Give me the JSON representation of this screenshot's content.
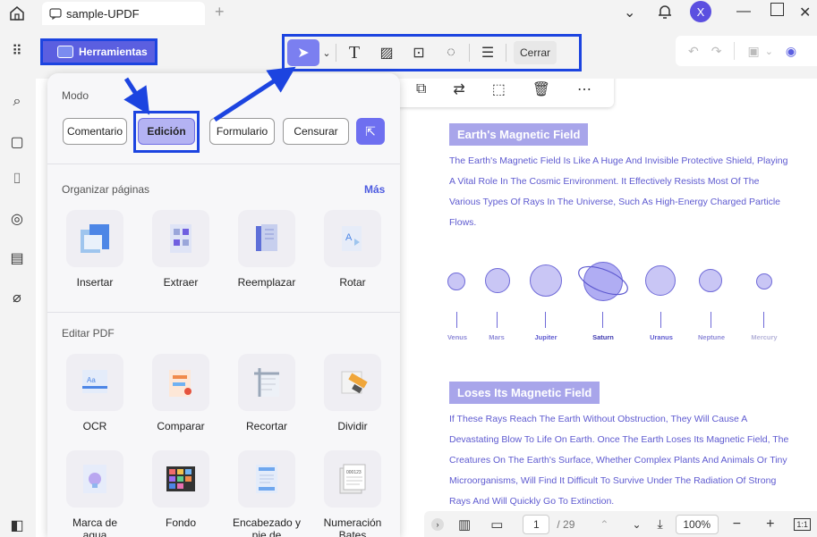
{
  "titlebar": {
    "tab_title": "sample-UPDF",
    "avatar_letter": "X"
  },
  "toolbar": {
    "tools_label": "Herramientas",
    "close_label": "Cerrar",
    "accent_color": "#5b5fe0",
    "highlight_color": "#1c44e0"
  },
  "panel": {
    "mode_title": "Modo",
    "modes": [
      "Comentario",
      "Edición",
      "Formulario",
      "Censurar"
    ],
    "active_mode": "Edición",
    "organize_title": "Organizar páginas",
    "more_label": "Más",
    "organize_tools": [
      "Insertar",
      "Extraer",
      "Reemplazar",
      "Rotar"
    ],
    "edit_title": "Editar PDF",
    "edit_tools": [
      "OCR",
      "Comparar",
      "Recortar",
      "Dividir"
    ],
    "edit_tools_row2": [
      "Marca de agua",
      "Fondo",
      "Encabezado y pie de",
      "Numeración Bates"
    ]
  },
  "document": {
    "heading1": "Earth's Magnetic Field",
    "para1": "The Earth's Magnetic Field Is Like A Huge And Invisible Protective Shield, Playing A Vital Role In The Cosmic Environment. It Effectively Resists Most Of The Various Types Of Rays In The Universe, Such As High-Energy Charged Particle Flows.",
    "planets": [
      "Venus",
      "Mars",
      "Jupiter",
      "Saturn",
      "Uranus",
      "Neptune",
      "Mercury"
    ],
    "heading2": "Loses Its Magnetic Field",
    "para2": "If These Rays Reach The Earth Without Obstruction, They Will Cause A Devastating Blow To Life On Earth. Once The Earth Loses Its Magnetic Field, The Creatures On The Earth's Surface, Whether Complex Plants And Animals Or Tiny Microorganisms, Will Find It Difficult To Survive Under The Radiation Of Strong Rays And Will Quickly Go To Extinction."
  },
  "status": {
    "current_page": "1",
    "total_pages": "/ 29",
    "zoom": "100%"
  }
}
